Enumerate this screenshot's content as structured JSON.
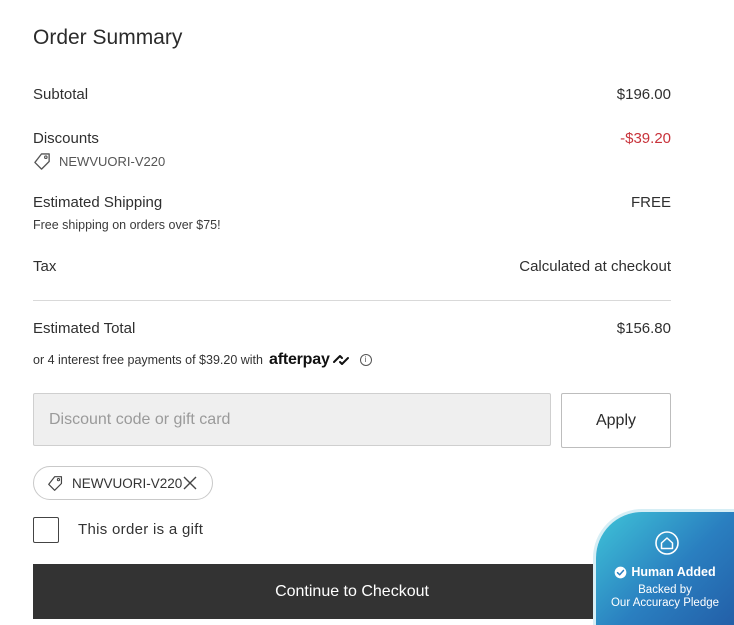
{
  "title": "Order Summary",
  "subtotal": {
    "label": "Subtotal",
    "value": "$196.00"
  },
  "discounts": {
    "label": "Discounts",
    "value": "-$39.20",
    "code": "NEWVUORI-V220",
    "color": "#c8333b"
  },
  "shipping": {
    "label": "Estimated Shipping",
    "value": "FREE",
    "note": "Free shipping on orders over $75!"
  },
  "tax": {
    "label": "Tax",
    "value": "Calculated at checkout"
  },
  "total": {
    "label": "Estimated Total",
    "value": "$156.80"
  },
  "afterpay": {
    "text": "or 4 interest free payments of $39.20 with",
    "brand": "afterpay",
    "info_icon": "info-icon"
  },
  "discount_form": {
    "placeholder": "Discount code or gift card",
    "value": "",
    "apply_label": "Apply"
  },
  "applied_code": {
    "code": "NEWVUORI-V220",
    "icon": "tag-icon",
    "remove_icon": "close-icon"
  },
  "gift": {
    "label": "This order is a gift",
    "checked": false
  },
  "checkout": {
    "label": "Continue to Checkout",
    "color": "#333333"
  },
  "badge": {
    "title": "Human Added",
    "line1": "Backed by",
    "line2": "Our Accuracy Pledge",
    "icon": "shield-home-icon"
  }
}
